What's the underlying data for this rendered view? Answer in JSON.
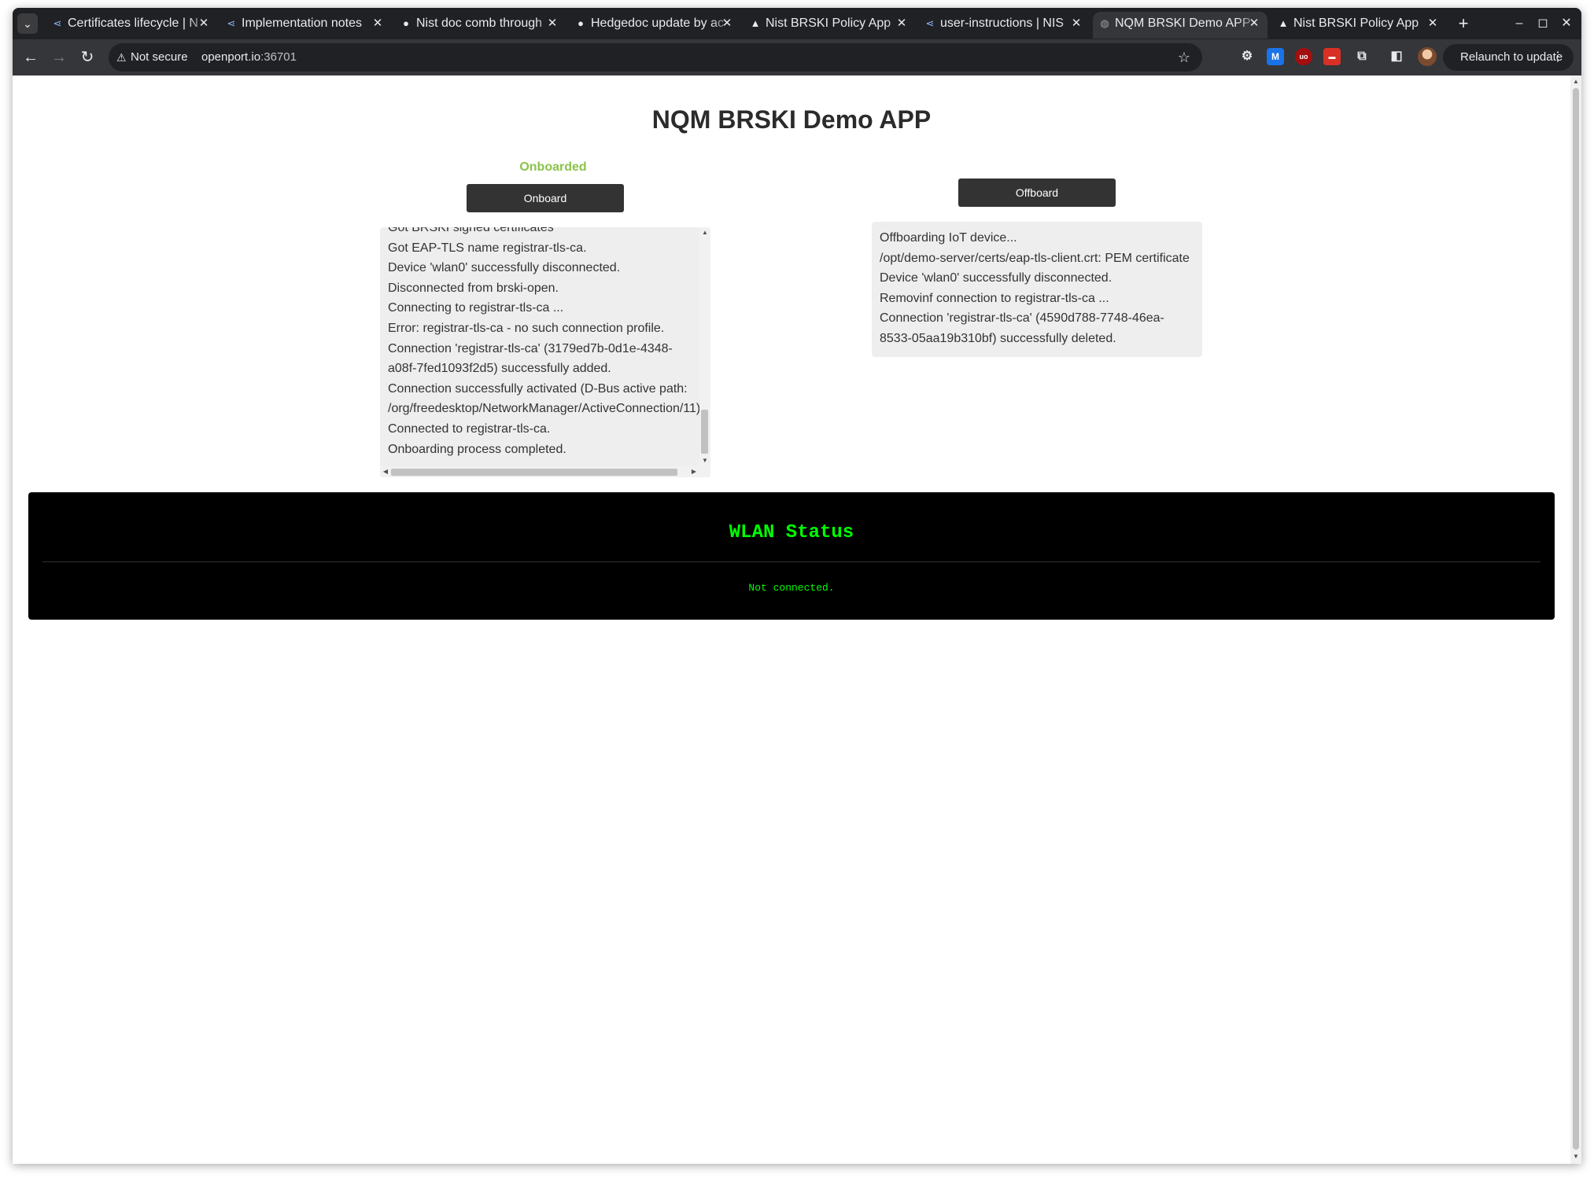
{
  "browser": {
    "tabs": [
      {
        "title": "Certificates lifecycle | N",
        "icon": "hedgedoc-icon"
      },
      {
        "title": "Implementation notes",
        "icon": "hedgedoc-icon"
      },
      {
        "title": "Nist doc comb through",
        "icon": "github-icon"
      },
      {
        "title": "Hedgedoc update by ac",
        "icon": "github-icon"
      },
      {
        "title": "Nist BRSKI Policy App",
        "icon": "app-icon"
      },
      {
        "title": "user-instructions | NIS",
        "icon": "hedgedoc-icon"
      },
      {
        "title": "NQM BRSKI Demo APP",
        "icon": "globe-icon",
        "active": true
      },
      {
        "title": "Nist BRSKI Policy App",
        "icon": "app-icon"
      }
    ],
    "security_label": "Not secure",
    "url_host": "openport.io",
    "url_rest": ":36701",
    "relaunch_label": "Relaunch to update"
  },
  "page": {
    "title": "NQM BRSKI Demo APP",
    "status": "Onboarded",
    "status_color": "#8bc34a",
    "onboard_label": "Onboard",
    "offboard_label": "Offboard",
    "onboard_log": [
      "Got BRSKI signed certificates",
      "Got EAP-TLS name registrar-tls-ca.",
      "Device 'wlan0' successfully disconnected.",
      "Disconnected from brski-open.",
      "Connecting to registrar-tls-ca ...",
      "Error: registrar-tls-ca - no such connection profile.",
      "Connection 'registrar-tls-ca' (3179ed7b-0d1e-4348-",
      "a08f-7fed1093f2d5) successfully added.",
      "Connection successfully activated (D-Bus active path:",
      "/org/freedesktop/NetworkManager/ActiveConnection/11)",
      "Connected to registrar-tls-ca.",
      "Onboarding process completed."
    ],
    "offboard_log": [
      "Offboarding IoT device...",
      "/opt/demo-server/certs/eap-tls-client.crt: PEM certificate",
      "Device 'wlan0' successfully disconnected.",
      "Removinf connection to registrar-tls-ca ...",
      "Connection 'registrar-tls-ca' (4590d788-7748-46ea-",
      "8533-05aa19b310bf) successfully deleted."
    ]
  },
  "wlan": {
    "title": "WLAN Status",
    "message": "Not connected.",
    "text_color": "#00ff00"
  }
}
